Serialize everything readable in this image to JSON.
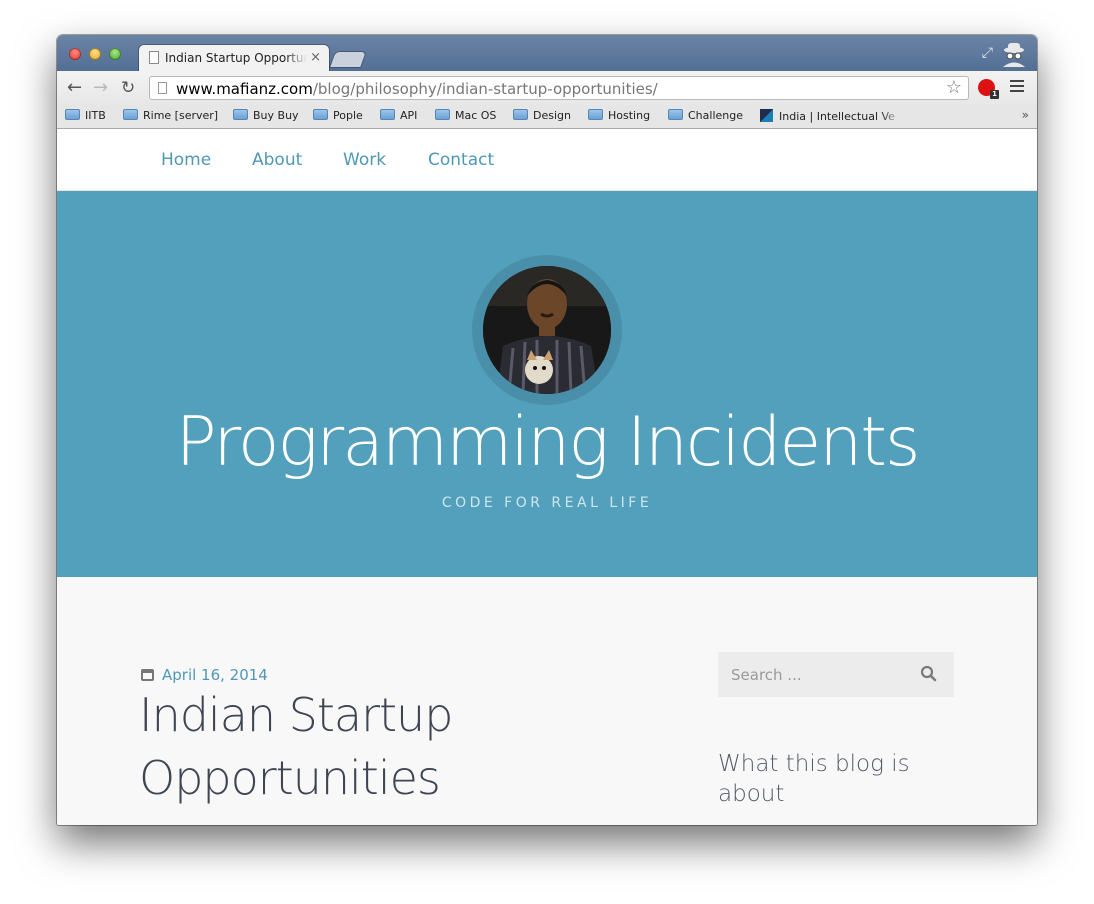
{
  "browser": {
    "tab_title": "Indian Startup Opportunities",
    "tab_close": "×",
    "url_host": "www.mafianz.com",
    "url_path": "/blog/philosophy/indian-startup-opportunities/",
    "ext_badge": "1",
    "bookmarks": [
      {
        "label": "IITB"
      },
      {
        "label": "Rime [server]"
      },
      {
        "label": "Buy Buy"
      },
      {
        "label": "Pople"
      },
      {
        "label": "API"
      },
      {
        "label": "Mac OS"
      },
      {
        "label": "Design"
      },
      {
        "label": "Hosting"
      },
      {
        "label": "Challenge"
      },
      {
        "label": "India | Intellectual Ve"
      }
    ],
    "bookmarks_more": "»"
  },
  "site": {
    "nav": [
      {
        "label": "Home"
      },
      {
        "label": "About"
      },
      {
        "label": "Work"
      },
      {
        "label": "Contact"
      }
    ],
    "title": "Programming Incidents",
    "tagline": "CODE FOR REAL LIFE"
  },
  "post": {
    "date": "April 16, 2014",
    "title": "Indian Startup Opportunities"
  },
  "sidebar": {
    "search_placeholder": "Search ...",
    "widget_title": "What this blog is about"
  },
  "colors": {
    "hero": "#52a0bb",
    "link": "#4f98b6",
    "title_text": "#3e4552"
  }
}
